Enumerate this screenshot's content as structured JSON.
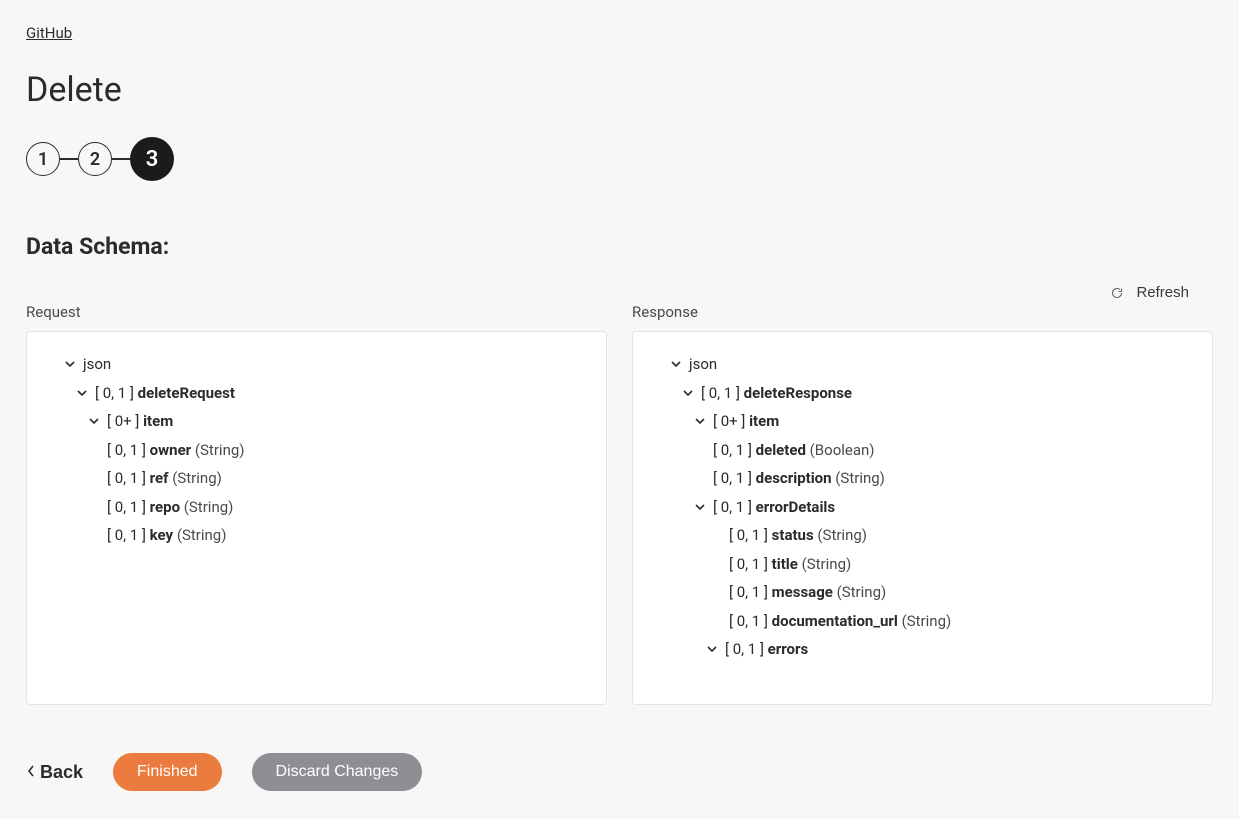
{
  "breadcrumb": {
    "link": "GitHub"
  },
  "title": "Delete",
  "steps": [
    "1",
    "2",
    "3"
  ],
  "activeStep": 2,
  "sectionHeading": "Data Schema:",
  "refreshLabel": "Refresh",
  "panels": {
    "request": {
      "label": "Request"
    },
    "response": {
      "label": "Response"
    }
  },
  "requestTree": {
    "root": "json",
    "rootCard": "[ 0, 1 ]",
    "rootName": "deleteRequest",
    "itemCard": "[ 0+ ]",
    "itemName": "item",
    "fields": [
      {
        "card": "[ 0, 1 ]",
        "name": "owner",
        "type": "(String)"
      },
      {
        "card": "[ 0, 1 ]",
        "name": "ref",
        "type": "(String)"
      },
      {
        "card": "[ 0, 1 ]",
        "name": "repo",
        "type": "(String)"
      },
      {
        "card": "[ 0, 1 ]",
        "name": "key",
        "type": "(String)"
      }
    ]
  },
  "responseTree": {
    "root": "json",
    "rootCard": "[ 0, 1 ]",
    "rootName": "deleteResponse",
    "itemCard": "[ 0+ ]",
    "itemName": "item",
    "itemFields": [
      {
        "card": "[ 0, 1 ]",
        "name": "deleted",
        "type": "(Boolean)"
      },
      {
        "card": "[ 0, 1 ]",
        "name": "description",
        "type": "(String)"
      }
    ],
    "errorDetailsCard": "[ 0, 1 ]",
    "errorDetailsName": "errorDetails",
    "errorFields": [
      {
        "card": "[ 0, 1 ]",
        "name": "status",
        "type": "(String)"
      },
      {
        "card": "[ 0, 1 ]",
        "name": "title",
        "type": "(String)"
      },
      {
        "card": "[ 0, 1 ]",
        "name": "message",
        "type": "(String)"
      },
      {
        "card": "[ 0, 1 ]",
        "name": "documentation_url",
        "type": "(String)"
      }
    ],
    "errorsCard": "[ 0, 1 ]",
    "errorsName": "errors"
  },
  "footer": {
    "back": "Back",
    "finished": "Finished",
    "discard": "Discard Changes"
  }
}
